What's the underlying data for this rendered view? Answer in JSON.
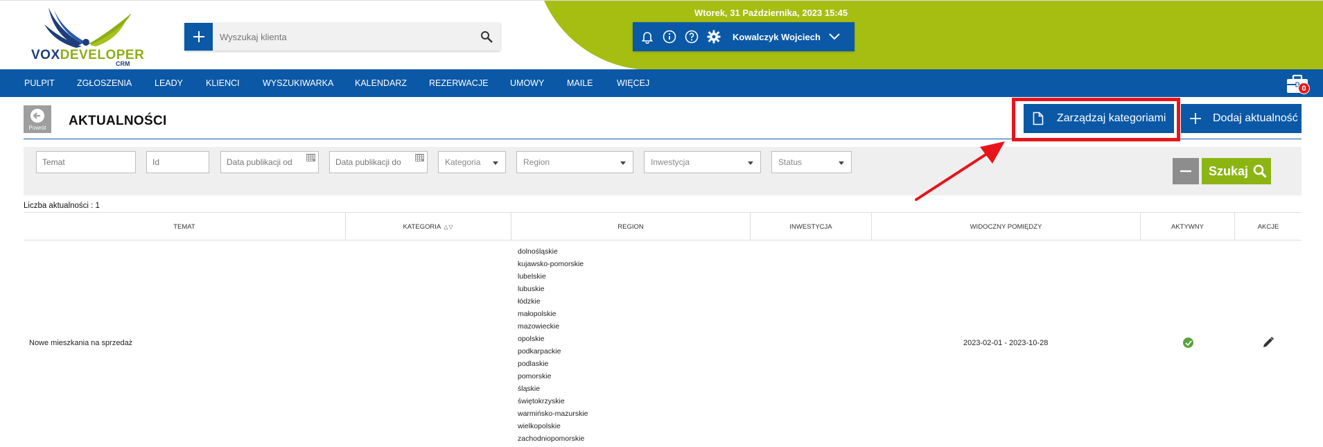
{
  "brand": {
    "logo_main": "VOX",
    "logo_dev": "DEVELOPER",
    "logo_sub": "CRM"
  },
  "header": {
    "search_placeholder": "Wyszukaj klienta",
    "datetime": "Wtorek, 31 Października, 2023   15:45",
    "user_name": "Kowalczyk Wojciech"
  },
  "nav": {
    "items": [
      "PULPIT",
      "ZGŁOSZENIA",
      "LEADY",
      "KLIENCI",
      "WYSZUKIWARKA",
      "KALENDARZ",
      "REZERWACJE",
      "UMOWY",
      "MAILE",
      "WIĘCEJ"
    ],
    "cart_count": "0"
  },
  "page": {
    "back_label": "Powrót",
    "title": "AKTUALNOŚCI",
    "manage_categories": "Zarządzaj kategoriami",
    "add_news": "Dodaj aktualność"
  },
  "filters": {
    "topic": "Temat",
    "id": "Id",
    "date_from": "Data publikacji od",
    "date_to": "Data publikacji do",
    "category": "Kategoria",
    "region": "Region",
    "investment": "Inwestycja",
    "status": "Status",
    "search_button": "Szukaj"
  },
  "table": {
    "count_label": "Liczba aktualności : 1",
    "columns": [
      "TEMAT",
      "KATEGORIA",
      "REGION",
      "INWESTYCJA",
      "WIDOCZNY POMIĘDZY",
      "AKTYWNY",
      "AKCJE"
    ],
    "sort_glyph": "△▽",
    "rows": [
      {
        "topic": "Nowe mieszkania na sprzedaż",
        "category": "",
        "regions": [
          "dolnośląskie",
          "kujawsko-pomorskie",
          "lubelskie",
          "lubuskie",
          "łódzkie",
          "małopolskie",
          "mazowieckie",
          "opolskie",
          "podkarpackie",
          "podlaskie",
          "pomorskie",
          "śląskie",
          "świętokrzyskie",
          "warmińsko-mazurskie",
          "wielkopolskie",
          "zachodniopomorskie"
        ],
        "investment": "",
        "visible_between": "2023-02-01 - 2023-10-28",
        "active": true
      }
    ]
  },
  "colors": {
    "primary": "#0a58a6",
    "accent_green": "#a6bd12",
    "search_green": "#8cb513",
    "highlight_red": "#e8141b"
  }
}
